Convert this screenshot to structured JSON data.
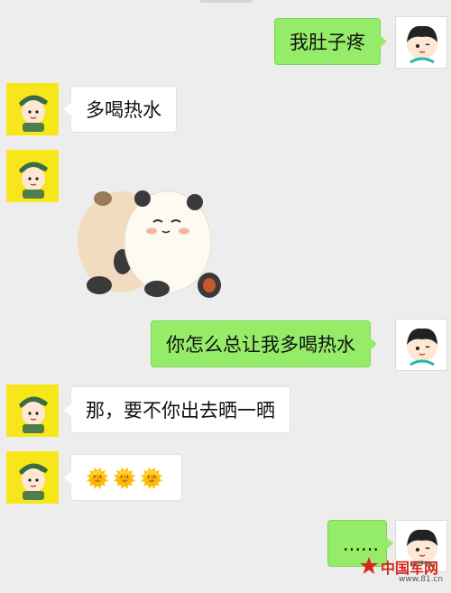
{
  "messages": [
    {
      "side": "right",
      "text": "我肚子疼"
    },
    {
      "side": "left",
      "text": "多喝热水"
    },
    {
      "side": "left",
      "sticker": "two-hugging-panda-sticker"
    },
    {
      "side": "right",
      "text": "你怎么总让我多喝热水"
    },
    {
      "side": "left",
      "text": "那，要不你出去晒一晒"
    },
    {
      "side": "left",
      "text": "🌞🌞🌞"
    },
    {
      "side": "right",
      "text": "......"
    }
  ],
  "watermark": {
    "text": "中国军网",
    "url": "www.81.cn"
  },
  "colors": {
    "background": "#ededed",
    "my_bubble": "#95ec69",
    "their_bubble": "#ffffff",
    "left_avatar_bg": "#f7e71a",
    "watermark_red": "#d9241b"
  }
}
